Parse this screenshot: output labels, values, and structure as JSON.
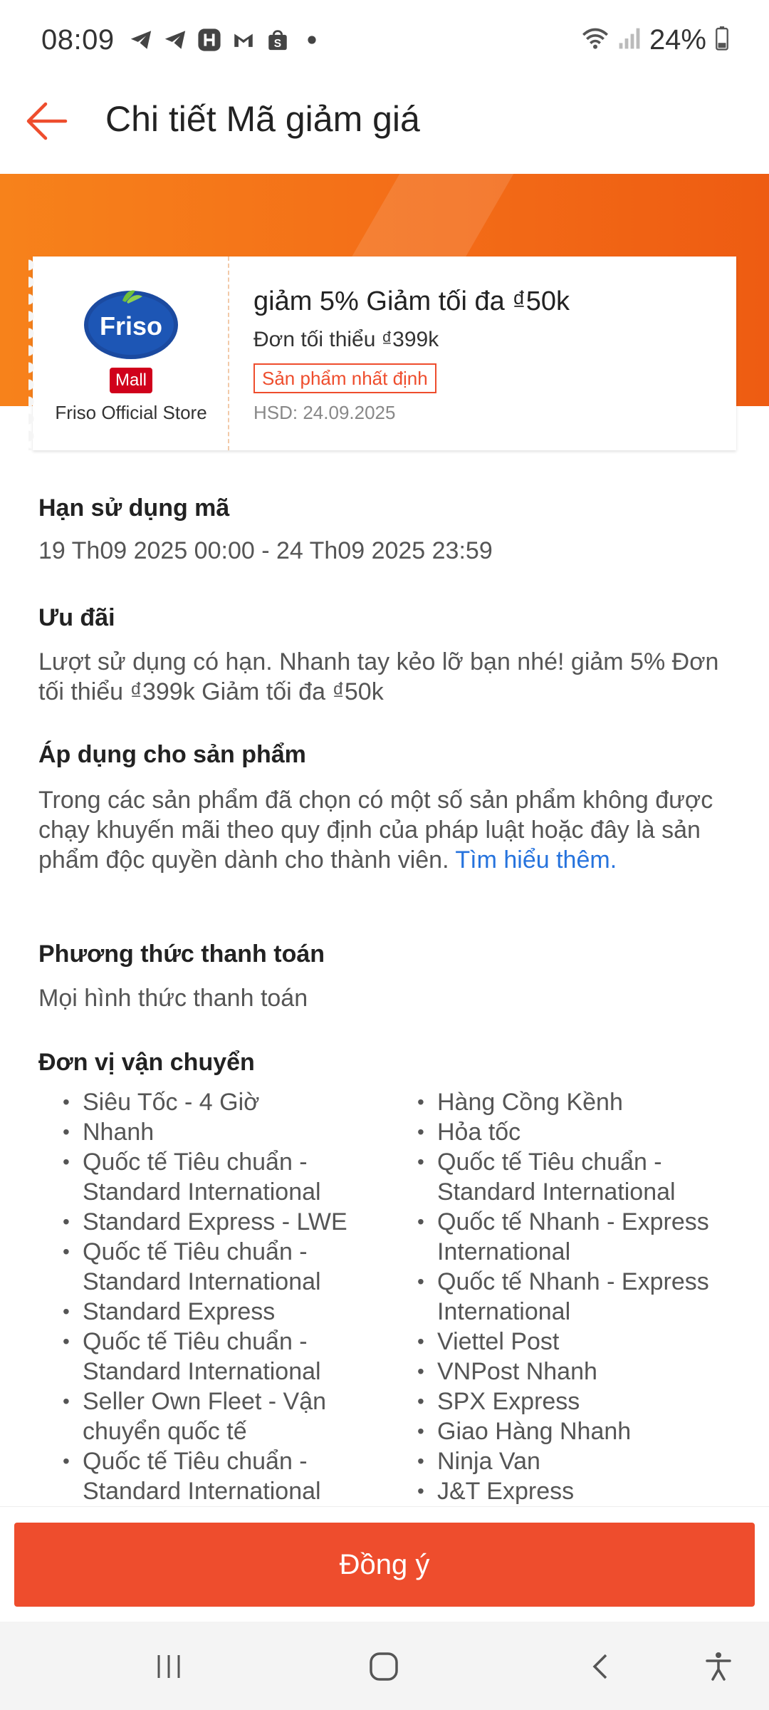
{
  "status_bar": {
    "time": "08:09",
    "battery": "24%",
    "icons": [
      "telegram-icon",
      "telegram-icon",
      "hack-icon",
      "gmail-icon",
      "shopee-icon",
      "dot-icon",
      "wifi-icon",
      "signal-icon",
      "battery-icon"
    ]
  },
  "header": {
    "title": "Chi tiết Mã giảm giá"
  },
  "voucher": {
    "store_logo_text": "Friso",
    "mall_badge": "Mall",
    "store_name": "Friso Official Store",
    "title": "giảm 5% Giảm tối đa ₫50k",
    "min_order": "Đơn tối thiểu ₫399k",
    "tag": "Sản phẩm nhất định",
    "expiry": "HSD: 24.09.2025"
  },
  "sections": {
    "validity": {
      "title": "Hạn sử dụng mã",
      "text": "19 Th09 2025 00:00 - 24 Th09 2025 23:59"
    },
    "offer": {
      "title": "Ưu đãi",
      "text": "Lượt sử dụng có hạn. Nhanh tay kẻo lỡ bạn nhé! giảm 5% Đơn tối thiểu ₫399k Giảm tối đa ₫50k"
    },
    "products": {
      "title": "Áp dụng cho sản phẩm",
      "text": "Trong các sản phẩm đã chọn có một số sản phẩm không được chạy khuyến mãi theo quy định của pháp luật hoặc đây là sản phẩm độc quyền dành cho thành viên.",
      "link": "Tìm hiểu thêm."
    },
    "payment": {
      "title": "Phương thức thanh toán",
      "text": "Mọi hình thức thanh toán"
    },
    "shipping": {
      "title": "Đơn vị vận chuyển",
      "left": [
        "Siêu Tốc - 4 Giờ",
        "Nhanh",
        "Quốc tế Tiêu chuẩn - Standard International",
        "Standard Express - LWE",
        "Quốc tế Tiêu chuẩn - Standard International",
        "Standard Express",
        "Quốc tế Tiêu chuẩn - Standard International",
        "Seller Own Fleet - Vận chuyển quốc tế",
        "Quốc tế Tiêu chuẩn - Standard International"
      ],
      "right": [
        "Hàng Cồng Kềnh",
        "Hỏa tốc",
        "Quốc tế Tiêu chuẩn - Standard International",
        "Quốc tế Nhanh - Express International",
        "Quốc tế Nhanh - Express International",
        "Viettel Post",
        "VNPost Nhanh",
        "SPX Express",
        "Giao Hàng Nhanh",
        "Ninja Van",
        "J&T Express"
      ]
    }
  },
  "footer": {
    "agree_label": "Đồng ý"
  },
  "colors": {
    "accent": "#ee4d2d",
    "banner": "#f36b17",
    "link": "#2673dd",
    "mall_badge": "#d0011b"
  }
}
